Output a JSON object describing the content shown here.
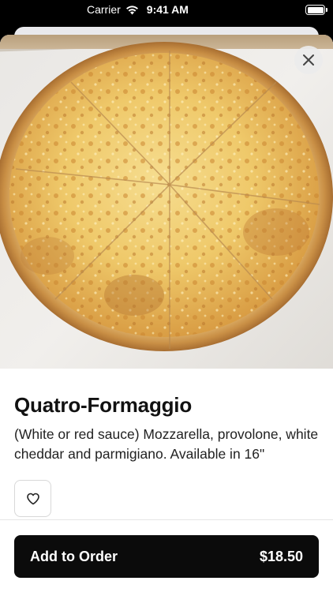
{
  "status_bar": {
    "carrier": "Carrier",
    "time": "9:41 AM",
    "wifi_icon": "wifi-icon",
    "battery_icon": "battery-icon"
  },
  "item": {
    "image_alt_icon": "pizza-photo",
    "title": "Quatro-Formaggio",
    "description": "(White or red sauce) Mozzarella, provolone, white cheddar and parmigiano. Available in 16\""
  },
  "controls": {
    "close_icon": "close-icon",
    "favorite_icon": "heart-icon"
  },
  "footer": {
    "button_label": "Add to Order",
    "price": "$18.50"
  },
  "colors": {
    "button_bg": "#0b0b0b",
    "button_text": "#ffffff",
    "title_text": "#111111"
  }
}
